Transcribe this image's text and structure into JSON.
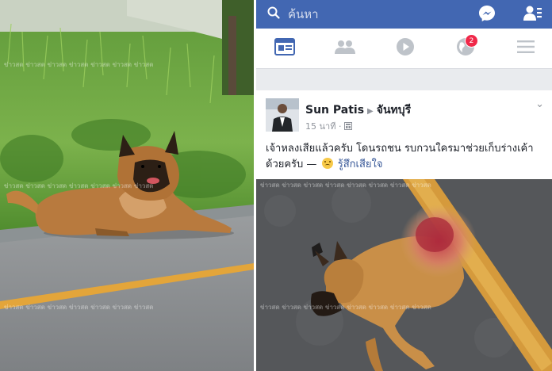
{
  "facebook": {
    "search": {
      "placeholder": "ค้นหา"
    },
    "tabs": {
      "notifications_badge": "2"
    },
    "post": {
      "author": "Sun Patis",
      "location": "จันทบุรี",
      "time": "15 นาที",
      "text": "เจ้าหลงเสียแล้วครับ โดนรถชน รบกวนใครมาช่วยเก็บร่างเค้าด้วยครับ —",
      "feeling": "รู้สึกเสียใจ"
    }
  },
  "watermark": "ข่าวสด",
  "colors": {
    "facebook_blue": "#4267b2",
    "badge_red": "#f02849"
  }
}
